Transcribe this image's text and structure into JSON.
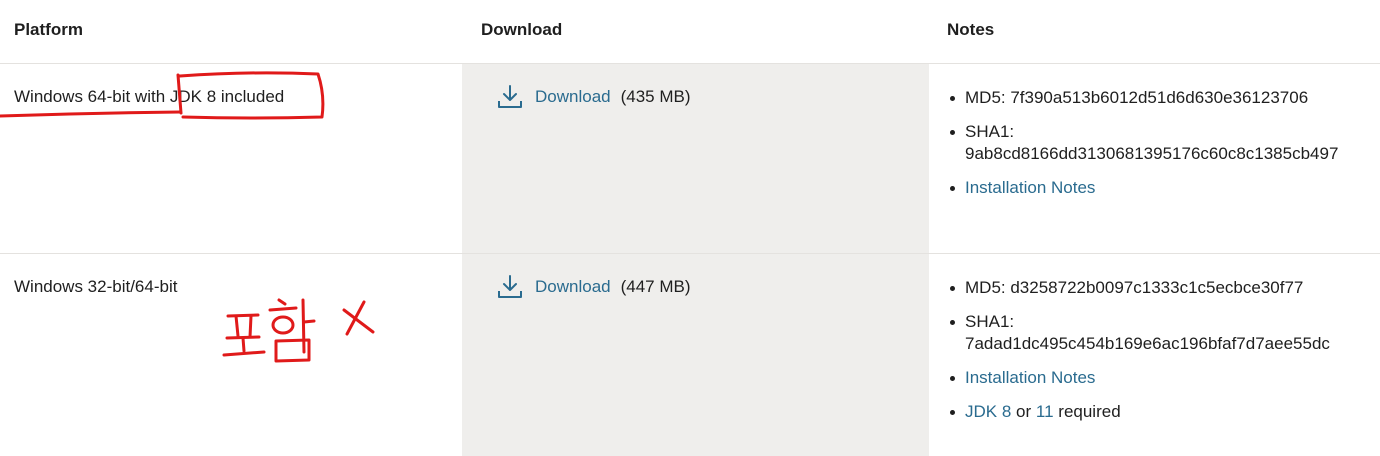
{
  "headers": {
    "platform": "Platform",
    "download": "Download",
    "notes": "Notes"
  },
  "rows": [
    {
      "platform": "Windows 64-bit with JDK 8 included",
      "download_label": "Download",
      "size": "(435 MB)",
      "md5": "MD5: 7f390a513b6012d51d6d630e36123706",
      "sha1_label": "SHA1:",
      "sha1_value": "9ab8cd8166dd3130681395176c60c8c1385cb497",
      "install_notes": "Installation Notes"
    },
    {
      "platform": "Windows 32-bit/64-bit",
      "download_label": "Download",
      "size": "(447 MB)",
      "md5": "MD5: d3258722b0097c1333c1c5ecbce30f77",
      "sha1_label": "SHA1:",
      "sha1_value": "7adad1dc495c454b169e6ac196bfaf7d7aee55dc",
      "install_notes": "Installation Notes",
      "req_jdk8": "JDK 8",
      "req_or": "or",
      "req_11": "11",
      "req_required": "required"
    }
  ],
  "annotation": {
    "handwritten_text": "포함 X",
    "color": "#e01a1a"
  },
  "colors": {
    "link": "#2a6b8f",
    "download_column_bg": "#efeeec",
    "divider": "#e4e2df"
  },
  "icons": {
    "download": "download-arrow-icon"
  }
}
